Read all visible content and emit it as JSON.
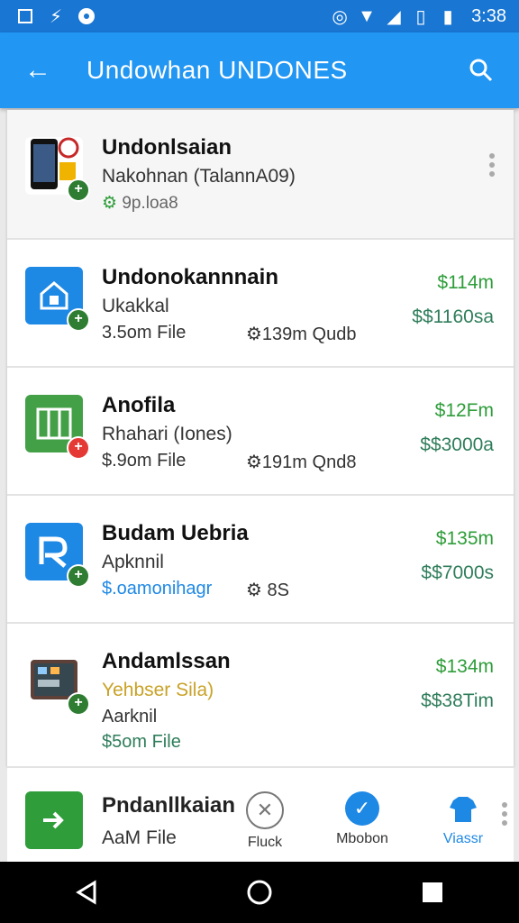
{
  "status": {
    "time": "3:38"
  },
  "appbar": {
    "title": "Undowhan UNDONES"
  },
  "items": [
    {
      "title": "Undonlsaian",
      "subtitle": "Nakohnan (TalannA09)",
      "meta": "9p.loa8",
      "price_top": "",
      "price_bottom": "",
      "icon": "phone-app-icon",
      "badge": "+",
      "badge_color": "#2e7d32",
      "icon_bg": "#111111"
    },
    {
      "title": "Undonokannnain",
      "subtitle": "Ukakkal",
      "meta": "3.5om File",
      "meta2": "⚙139m Qudb",
      "price_top": "$114m",
      "price_bottom": "$$1160sa",
      "icon": "house-app-icon",
      "badge": "+",
      "badge_color": "#2e7d32",
      "icon_bg": "#1e88e5"
    },
    {
      "title": "Anofila",
      "subtitle": "Rhahari (Iones)",
      "meta": "$.9om File",
      "meta2": "⚙191m Qnd8",
      "price_top": "$12Fm",
      "price_bottom": "$$3000a",
      "icon": "grid-app-icon",
      "badge": "+",
      "badge_color": "#e53935",
      "icon_bg": "#43a047"
    },
    {
      "title": "Budam Uebria",
      "subtitle": "Apknnil",
      "meta": "$.oamonihagr",
      "meta2": "⚙ 8S",
      "price_top": "$135m",
      "price_bottom": "$$7000s",
      "icon": "r-app-icon",
      "badge": "+",
      "badge_color": "#2e7d32",
      "icon_bg": "#1e88e5"
    },
    {
      "title": "Andamlssan",
      "subtitle": "Yehbser Sila)",
      "subtitle2": "Aarknil",
      "meta": "$5om File",
      "price_top": "$134m",
      "price_bottom": "$$38Tim",
      "icon": "tablet-app-icon",
      "badge": "+",
      "badge_color": "#2e7d32",
      "icon_bg": "#333333"
    }
  ],
  "bottom": {
    "title": "Pndanllkaian",
    "subtitle": "AaM File",
    "actions": [
      {
        "label": "Fluck",
        "icon": "close-circle-icon"
      },
      {
        "label": "Mbobon",
        "icon": "check-circle-icon"
      },
      {
        "label": "Viassr",
        "icon": "shirt-icon"
      }
    ]
  },
  "colors": {
    "statusbar": "#1976d2",
    "appbar": "#2196f3",
    "price_green": "#2e9d3a",
    "link_blue": "#1e88e5"
  }
}
